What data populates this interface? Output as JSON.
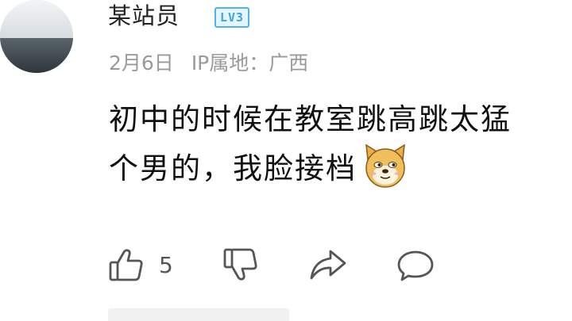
{
  "comment": {
    "username": "某站员",
    "level_badge": "LV3",
    "date": "2月6日",
    "ip_location": "IP属地：广西",
    "content_line1": "初中的时候在教室跳高跳太猛",
    "content_line2": "个男的，我脸接档",
    "emoji": "doge-emoji",
    "like_count": "5"
  },
  "icons": {
    "like": "thumbs-up-icon",
    "dislike": "thumbs-down-icon",
    "share": "share-icon",
    "reply": "comment-icon"
  },
  "colors": {
    "username": "#222222",
    "meta": "#9a9a9a",
    "badge": "#35a6ea",
    "icon": "#555555"
  }
}
